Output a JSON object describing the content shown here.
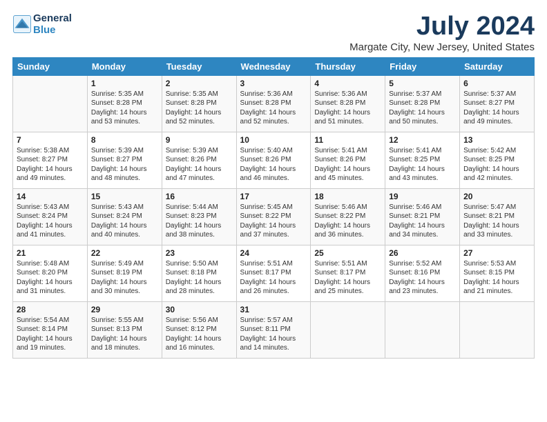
{
  "logo": {
    "line1": "General",
    "line2": "Blue"
  },
  "title": "July 2024",
  "subtitle": "Margate City, New Jersey, United States",
  "weekdays": [
    "Sunday",
    "Monday",
    "Tuesday",
    "Wednesday",
    "Thursday",
    "Friday",
    "Saturday"
  ],
  "weeks": [
    [
      {
        "day": "",
        "info": ""
      },
      {
        "day": "1",
        "info": "Sunrise: 5:35 AM\nSunset: 8:28 PM\nDaylight: 14 hours\nand 53 minutes."
      },
      {
        "day": "2",
        "info": "Sunrise: 5:35 AM\nSunset: 8:28 PM\nDaylight: 14 hours\nand 52 minutes."
      },
      {
        "day": "3",
        "info": "Sunrise: 5:36 AM\nSunset: 8:28 PM\nDaylight: 14 hours\nand 52 minutes."
      },
      {
        "day": "4",
        "info": "Sunrise: 5:36 AM\nSunset: 8:28 PM\nDaylight: 14 hours\nand 51 minutes."
      },
      {
        "day": "5",
        "info": "Sunrise: 5:37 AM\nSunset: 8:28 PM\nDaylight: 14 hours\nand 50 minutes."
      },
      {
        "day": "6",
        "info": "Sunrise: 5:37 AM\nSunset: 8:27 PM\nDaylight: 14 hours\nand 49 minutes."
      }
    ],
    [
      {
        "day": "7",
        "info": "Sunrise: 5:38 AM\nSunset: 8:27 PM\nDaylight: 14 hours\nand 49 minutes."
      },
      {
        "day": "8",
        "info": "Sunrise: 5:39 AM\nSunset: 8:27 PM\nDaylight: 14 hours\nand 48 minutes."
      },
      {
        "day": "9",
        "info": "Sunrise: 5:39 AM\nSunset: 8:26 PM\nDaylight: 14 hours\nand 47 minutes."
      },
      {
        "day": "10",
        "info": "Sunrise: 5:40 AM\nSunset: 8:26 PM\nDaylight: 14 hours\nand 46 minutes."
      },
      {
        "day": "11",
        "info": "Sunrise: 5:41 AM\nSunset: 8:26 PM\nDaylight: 14 hours\nand 45 minutes."
      },
      {
        "day": "12",
        "info": "Sunrise: 5:41 AM\nSunset: 8:25 PM\nDaylight: 14 hours\nand 43 minutes."
      },
      {
        "day": "13",
        "info": "Sunrise: 5:42 AM\nSunset: 8:25 PM\nDaylight: 14 hours\nand 42 minutes."
      }
    ],
    [
      {
        "day": "14",
        "info": "Sunrise: 5:43 AM\nSunset: 8:24 PM\nDaylight: 14 hours\nand 41 minutes."
      },
      {
        "day": "15",
        "info": "Sunrise: 5:43 AM\nSunset: 8:24 PM\nDaylight: 14 hours\nand 40 minutes."
      },
      {
        "day": "16",
        "info": "Sunrise: 5:44 AM\nSunset: 8:23 PM\nDaylight: 14 hours\nand 38 minutes."
      },
      {
        "day": "17",
        "info": "Sunrise: 5:45 AM\nSunset: 8:22 PM\nDaylight: 14 hours\nand 37 minutes."
      },
      {
        "day": "18",
        "info": "Sunrise: 5:46 AM\nSunset: 8:22 PM\nDaylight: 14 hours\nand 36 minutes."
      },
      {
        "day": "19",
        "info": "Sunrise: 5:46 AM\nSunset: 8:21 PM\nDaylight: 14 hours\nand 34 minutes."
      },
      {
        "day": "20",
        "info": "Sunrise: 5:47 AM\nSunset: 8:21 PM\nDaylight: 14 hours\nand 33 minutes."
      }
    ],
    [
      {
        "day": "21",
        "info": "Sunrise: 5:48 AM\nSunset: 8:20 PM\nDaylight: 14 hours\nand 31 minutes."
      },
      {
        "day": "22",
        "info": "Sunrise: 5:49 AM\nSunset: 8:19 PM\nDaylight: 14 hours\nand 30 minutes."
      },
      {
        "day": "23",
        "info": "Sunrise: 5:50 AM\nSunset: 8:18 PM\nDaylight: 14 hours\nand 28 minutes."
      },
      {
        "day": "24",
        "info": "Sunrise: 5:51 AM\nSunset: 8:17 PM\nDaylight: 14 hours\nand 26 minutes."
      },
      {
        "day": "25",
        "info": "Sunrise: 5:51 AM\nSunset: 8:17 PM\nDaylight: 14 hours\nand 25 minutes."
      },
      {
        "day": "26",
        "info": "Sunrise: 5:52 AM\nSunset: 8:16 PM\nDaylight: 14 hours\nand 23 minutes."
      },
      {
        "day": "27",
        "info": "Sunrise: 5:53 AM\nSunset: 8:15 PM\nDaylight: 14 hours\nand 21 minutes."
      }
    ],
    [
      {
        "day": "28",
        "info": "Sunrise: 5:54 AM\nSunset: 8:14 PM\nDaylight: 14 hours\nand 19 minutes."
      },
      {
        "day": "29",
        "info": "Sunrise: 5:55 AM\nSunset: 8:13 PM\nDaylight: 14 hours\nand 18 minutes."
      },
      {
        "day": "30",
        "info": "Sunrise: 5:56 AM\nSunset: 8:12 PM\nDaylight: 14 hours\nand 16 minutes."
      },
      {
        "day": "31",
        "info": "Sunrise: 5:57 AM\nSunset: 8:11 PM\nDaylight: 14 hours\nand 14 minutes."
      },
      {
        "day": "",
        "info": ""
      },
      {
        "day": "",
        "info": ""
      },
      {
        "day": "",
        "info": ""
      }
    ]
  ]
}
